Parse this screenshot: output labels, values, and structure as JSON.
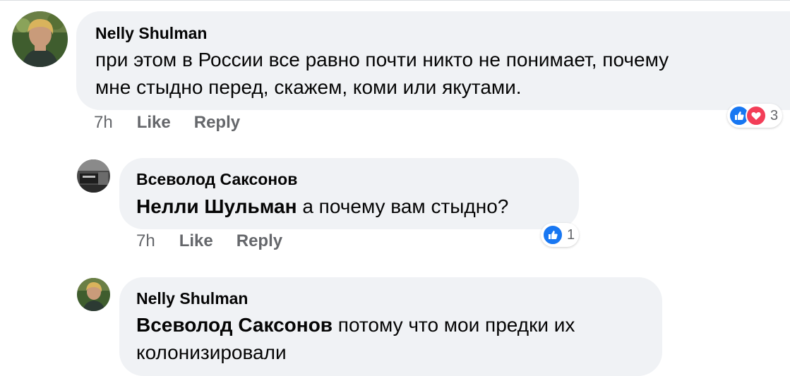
{
  "comments": [
    {
      "author": "Nelly Shulman",
      "mention": "",
      "line1": "при этом в России все равно почти никто не понимает, почему",
      "line2": "мне стыдно перед, скажем, коми или якутами.",
      "time": "7h",
      "like_label": "Like",
      "reply_label": "Reply",
      "reaction_icons": [
        "like-icon",
        "love-icon"
      ],
      "reaction_count": "3"
    },
    {
      "author": "Всеволод Саксонов",
      "mention": "Нелли Шульман",
      "line1": "а почему вам стыдно?",
      "time": "7h",
      "like_label": "Like",
      "reply_label": "Reply",
      "reaction_icons": [
        "like-icon"
      ],
      "reaction_count": "1"
    },
    {
      "author": "Nelly Shulman",
      "mention": "Всеволод Саксонов",
      "line1": "потому что мои предки их",
      "line2": "колонизировали"
    }
  ],
  "colors": {
    "bubble": "#f0f2f5",
    "like_blue": "#1877f2",
    "love_red": "#f33e58",
    "meta_gray": "#65676b"
  }
}
